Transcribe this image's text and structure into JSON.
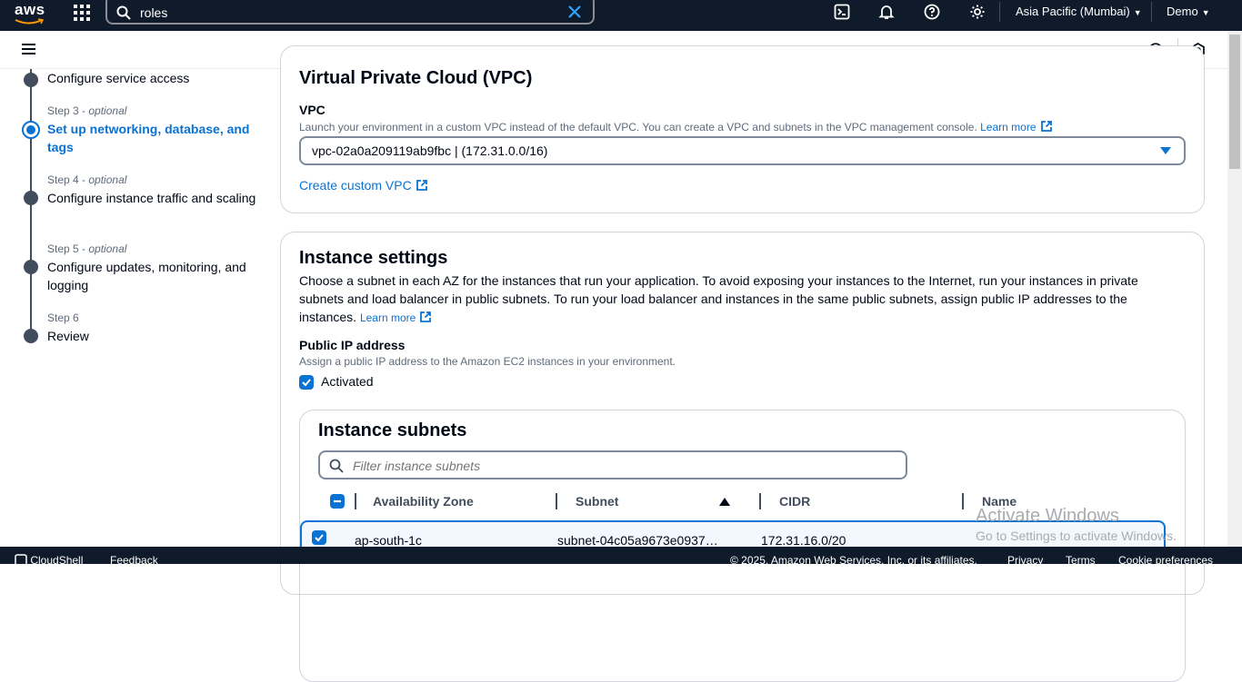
{
  "topnav": {
    "logo": "aws",
    "search_value": "roles",
    "region": "Asia Pacific (Mumbai)",
    "user": "Demo",
    "icons": [
      "apps-grid-icon",
      "search-icon",
      "clear-icon",
      "cloudshell-icon",
      "bell-icon",
      "help-icon",
      "gear-icon"
    ]
  },
  "subbar": {
    "icons": [
      "menu-icon",
      "info-icon",
      "hexagon-settings-icon"
    ]
  },
  "steps": [
    {
      "label": "",
      "title": "Configure service access",
      "active": false
    },
    {
      "label_prefix": "Step 3",
      "label_suffix": "optional",
      "title": "Set up networking, database, and tags",
      "active": true
    },
    {
      "label_prefix": "Step 4",
      "label_suffix": "optional",
      "title": "Configure instance traffic and scaling",
      "active": false
    },
    {
      "label_prefix": "Step 5",
      "label_suffix": "optional",
      "title": "Configure updates, monitoring, and logging",
      "active": false
    },
    {
      "label_prefix": "Step 6",
      "label_suffix": "",
      "title": "Review",
      "active": false
    }
  ],
  "vpc_section": {
    "title": "Virtual Private Cloud (VPC)",
    "field_label": "VPC",
    "description": "Launch your environment in a custom VPC instead of the default VPC. You can create a VPC and subnets in the VPC management console.",
    "learn_more": "Learn more",
    "selected_vpc": "vpc-02a0a209119ab9fbc | (172.31.0.0/16)",
    "create_link": "Create custom VPC"
  },
  "instance_section": {
    "title": "Instance settings",
    "description": "Choose a subnet in each AZ for the instances that run your application. To avoid exposing your instances to the Internet, run your instances in private subnets and load balancer in public subnets. To run your load balancer and instances in the same public subnets, assign public IP addresses to the instances.",
    "learn_more": "Learn more",
    "public_ip_label": "Public IP address",
    "public_ip_desc": "Assign a public IP address to the Amazon EC2 instances in your environment.",
    "activated_label": "Activated",
    "activated": true
  },
  "subnets": {
    "title": "Instance subnets",
    "filter_placeholder": "Filter instance subnets",
    "columns": [
      "Availability Zone",
      "Subnet",
      "CIDR",
      "Name"
    ],
    "rows": [
      {
        "az": "ap-south-1c",
        "subnet": "subnet-04c05a9673e0937…",
        "cidr": "172.31.16.0/20",
        "name": "",
        "selected": true
      }
    ]
  },
  "footer": {
    "cloudshell": "CloudShell",
    "feedback": "Feedback",
    "copyright": "© 2025, Amazon Web Services, Inc. or its affiliates.",
    "privacy": "Privacy",
    "terms": "Terms",
    "cookies": "Cookie preferences"
  },
  "watermark": {
    "title": "Activate Windows",
    "subtitle": "Go to Settings to activate Windows."
  },
  "colors": {
    "nav_bg": "#0f1b2a",
    "accent": "#0972d3",
    "text": "#000716",
    "muted": "#5f6b7a"
  }
}
